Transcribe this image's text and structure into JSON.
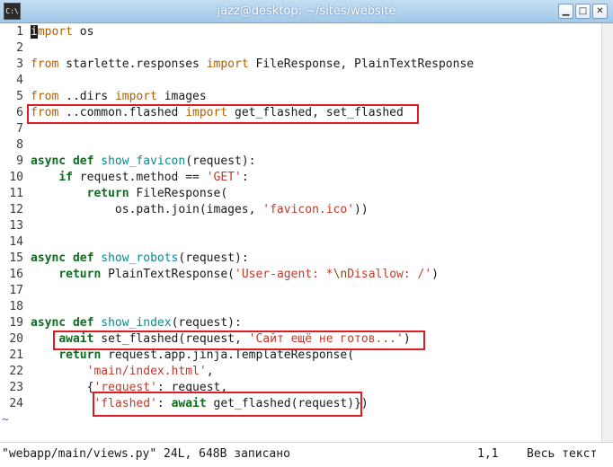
{
  "window": {
    "title": "jazz@desktop: ~/sites/website",
    "icon_label": "C:\\",
    "minimize_glyph": "▁",
    "maximize_glyph": "□",
    "close_glyph": "✕"
  },
  "editor": {
    "lines": [
      {
        "num": "1",
        "segs": [
          {
            "t": "i",
            "c": "cursor"
          },
          {
            "t": "mport",
            "c": "kw"
          },
          {
            "t": " os",
            "c": ""
          }
        ]
      },
      {
        "num": "2",
        "segs": []
      },
      {
        "num": "3",
        "segs": [
          {
            "t": "from",
            "c": "kw"
          },
          {
            "t": " starlette.responses ",
            "c": ""
          },
          {
            "t": "import",
            "c": "kw"
          },
          {
            "t": " FileResponse, PlainTextResponse",
            "c": ""
          }
        ]
      },
      {
        "num": "4",
        "segs": []
      },
      {
        "num": "5",
        "segs": [
          {
            "t": "from",
            "c": "kw"
          },
          {
            "t": " ..dirs ",
            "c": ""
          },
          {
            "t": "import",
            "c": "kw"
          },
          {
            "t": " images",
            "c": ""
          }
        ]
      },
      {
        "num": "6",
        "segs": [
          {
            "t": "from",
            "c": "kw"
          },
          {
            "t": " ..common.flashed ",
            "c": ""
          },
          {
            "t": "import",
            "c": "kw"
          },
          {
            "t": " get_flashed, set_flashed",
            "c": ""
          }
        ]
      },
      {
        "num": "7",
        "segs": []
      },
      {
        "num": "8",
        "segs": []
      },
      {
        "num": "9",
        "segs": [
          {
            "t": "async",
            "c": "kw2"
          },
          {
            "t": " ",
            "c": ""
          },
          {
            "t": "def",
            "c": "kw2"
          },
          {
            "t": " ",
            "c": ""
          },
          {
            "t": "show_favicon",
            "c": "fn"
          },
          {
            "t": "(request):",
            "c": ""
          }
        ]
      },
      {
        "num": "10",
        "segs": [
          {
            "t": "    ",
            "c": ""
          },
          {
            "t": "if",
            "c": "kw2"
          },
          {
            "t": " request.method == ",
            "c": ""
          },
          {
            "t": "'GET'",
            "c": "str"
          },
          {
            "t": ":",
            "c": ""
          }
        ]
      },
      {
        "num": "11",
        "segs": [
          {
            "t": "        ",
            "c": ""
          },
          {
            "t": "return",
            "c": "kw2"
          },
          {
            "t": " FileResponse(",
            "c": ""
          }
        ]
      },
      {
        "num": "12",
        "segs": [
          {
            "t": "            os.path.join(images, ",
            "c": ""
          },
          {
            "t": "'favicon.ico'",
            "c": "str"
          },
          {
            "t": "))",
            "c": ""
          }
        ]
      },
      {
        "num": "13",
        "segs": []
      },
      {
        "num": "14",
        "segs": []
      },
      {
        "num": "15",
        "segs": [
          {
            "t": "async",
            "c": "kw2"
          },
          {
            "t": " ",
            "c": ""
          },
          {
            "t": "def",
            "c": "kw2"
          },
          {
            "t": " ",
            "c": ""
          },
          {
            "t": "show_robots",
            "c": "fn"
          },
          {
            "t": "(request):",
            "c": ""
          }
        ]
      },
      {
        "num": "16",
        "segs": [
          {
            "t": "    ",
            "c": ""
          },
          {
            "t": "return",
            "c": "kw2"
          },
          {
            "t": " PlainTextResponse(",
            "c": ""
          },
          {
            "t": "'User-agent: *",
            "c": "str"
          },
          {
            "t": "\\n",
            "c": "esc"
          },
          {
            "t": "Disallow: /'",
            "c": "str"
          },
          {
            "t": ")",
            "c": ""
          }
        ]
      },
      {
        "num": "17",
        "segs": []
      },
      {
        "num": "18",
        "segs": []
      },
      {
        "num": "19",
        "segs": [
          {
            "t": "async",
            "c": "kw2"
          },
          {
            "t": " ",
            "c": ""
          },
          {
            "t": "def",
            "c": "kw2"
          },
          {
            "t": " ",
            "c": ""
          },
          {
            "t": "show_index",
            "c": "fn"
          },
          {
            "t": "(request):",
            "c": ""
          }
        ]
      },
      {
        "num": "20",
        "segs": [
          {
            "t": "    ",
            "c": ""
          },
          {
            "t": "await",
            "c": "kw2"
          },
          {
            "t": " set_flashed(request, ",
            "c": ""
          },
          {
            "t": "'Сайт ещё не готов...'",
            "c": "str"
          },
          {
            "t": ")",
            "c": ""
          }
        ]
      },
      {
        "num": "21",
        "segs": [
          {
            "t": "    ",
            "c": ""
          },
          {
            "t": "return",
            "c": "kw2"
          },
          {
            "t": " request.app.jinja.TemplateResponse(",
            "c": ""
          }
        ]
      },
      {
        "num": "22",
        "segs": [
          {
            "t": "        ",
            "c": ""
          },
          {
            "t": "'main/index.html'",
            "c": "str"
          },
          {
            "t": ",",
            "c": ""
          }
        ]
      },
      {
        "num": "23",
        "segs": [
          {
            "t": "        {",
            "c": ""
          },
          {
            "t": "'request'",
            "c": "str"
          },
          {
            "t": ": request,",
            "c": ""
          }
        ]
      },
      {
        "num": "24",
        "segs": [
          {
            "t": "         ",
            "c": ""
          },
          {
            "t": "'flashed'",
            "c": "str"
          },
          {
            "t": ": ",
            "c": ""
          },
          {
            "t": "await",
            "c": "kw2"
          },
          {
            "t": " get_flashed(request)})",
            "c": ""
          }
        ]
      }
    ],
    "empty_marker": "~",
    "empty_lines": 1
  },
  "status": {
    "file_message": "\"webapp/main/views.py\" 24L, 648B записано",
    "position": "1,1",
    "scroll": "Весь текст"
  },
  "colors": {
    "highlight_box": "#e01b24",
    "keyword": "#af5f00",
    "statement": "#0f6b20",
    "function": "#0b8a8a",
    "string": "#c0392b"
  }
}
